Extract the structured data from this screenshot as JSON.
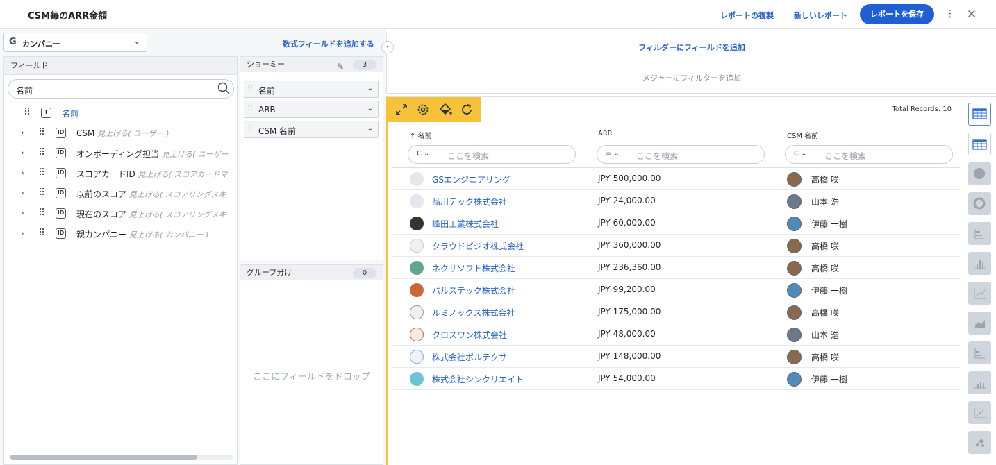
{
  "header": {
    "title": "CSM毎のARR金額",
    "duplicate_label": "レポートの複製",
    "new_label": "新しいレポート",
    "save_label": "レポートを保存"
  },
  "left": {
    "object_icon": "G",
    "object_name": "カンパニー",
    "add_formula": "数式フィールドを追加する",
    "fields_header": "フィールド",
    "search_value": "名前",
    "fields": [
      {
        "name": "名前",
        "sub": "",
        "icon": "T"
      },
      {
        "name": "CSM",
        "sub": "見上げる( ユーザー )",
        "icon": "ID"
      },
      {
        "name": "オンボーディング担当",
        "sub": "見上げる( ユーザー",
        "icon": "ID"
      },
      {
        "name": "スコアカードID",
        "sub": "見上げる( スコアカードマ",
        "icon": "ID"
      },
      {
        "name": "以前のスコア",
        "sub": "見上げる( スコアリングスキ",
        "icon": "ID"
      },
      {
        "name": "現在のスコア",
        "sub": "見上げる( スコアリングスキ",
        "icon": "ID"
      },
      {
        "name": "親カンパニー",
        "sub": "見上げる( カンパニー )",
        "icon": "ID"
      }
    ],
    "show_me": {
      "label": "ショーミー",
      "count": "3",
      "items": [
        "名前",
        "ARR",
        "CSM 名前"
      ]
    },
    "group_by": {
      "label": "グループ分け",
      "count": "0",
      "drop_text": "ここにフィールドをドロップ"
    }
  },
  "filters": {
    "add_field": "フィルダーにフィールドを追加",
    "add_measure": "メジャーにフィルターを追加"
  },
  "table": {
    "total_records": "Total Records: 10",
    "columns": [
      {
        "label": "名前",
        "op": "C",
        "placeholder": "ここを検索",
        "sort": "↑"
      },
      {
        "label": "ARR",
        "op": "=",
        "placeholder": "ここを検索",
        "sort": ""
      },
      {
        "label": "CSM 名前",
        "op": "C",
        "placeholder": "ここを検索",
        "sort": ""
      }
    ],
    "rows": [
      {
        "company": "GSエンジニアリング",
        "arr": "JPY 500,000.00",
        "csm": "高橋 咲"
      },
      {
        "company": "品川テック株式会社",
        "arr": "JPY 24,000.00",
        "csm": "山本 浩"
      },
      {
        "company": "峰田工業株式会社",
        "arr": "JPY 60,000.00",
        "csm": "伊藤 一樹"
      },
      {
        "company": "クラウドビジオ株式会社",
        "arr": "JPY 360,000.00",
        "csm": "高橋 咲"
      },
      {
        "company": "ネクサソフト株式会社",
        "arr": "JPY 236,360.00",
        "csm": "高橋 咲"
      },
      {
        "company": "パルステック株式会社",
        "arr": "JPY 99,200.00",
        "csm": "伊藤 一樹"
      },
      {
        "company": "ルミノックス株式会社",
        "arr": "JPY 175,000.00",
        "csm": "高橋 咲"
      },
      {
        "company": "クロスワン株式会社",
        "arr": "JPY 48,000.00",
        "csm": "山本 浩"
      },
      {
        "company": "株式会社ボルテクサ",
        "arr": "JPY 148,000.00",
        "csm": "高橋 咲"
      },
      {
        "company": "株式会社シンクリエイト",
        "arr": "JPY 54,000.00",
        "csm": "伊藤 一樹"
      }
    ]
  },
  "viz_types": [
    "table-icon",
    "pivot-table-icon",
    "pie-chart-icon",
    "donut-chart-icon",
    "bar-chart-icon",
    "column-chart-icon",
    "line-chart-icon",
    "area-chart-icon",
    "stacked-bar-icon",
    "stacked-column-icon",
    "scatter-chart-icon",
    "bubble-chart-icon"
  ],
  "colors": {
    "accent": "#1f5fd6",
    "link": "#2663c9",
    "toolbar": "#f5c23a"
  }
}
